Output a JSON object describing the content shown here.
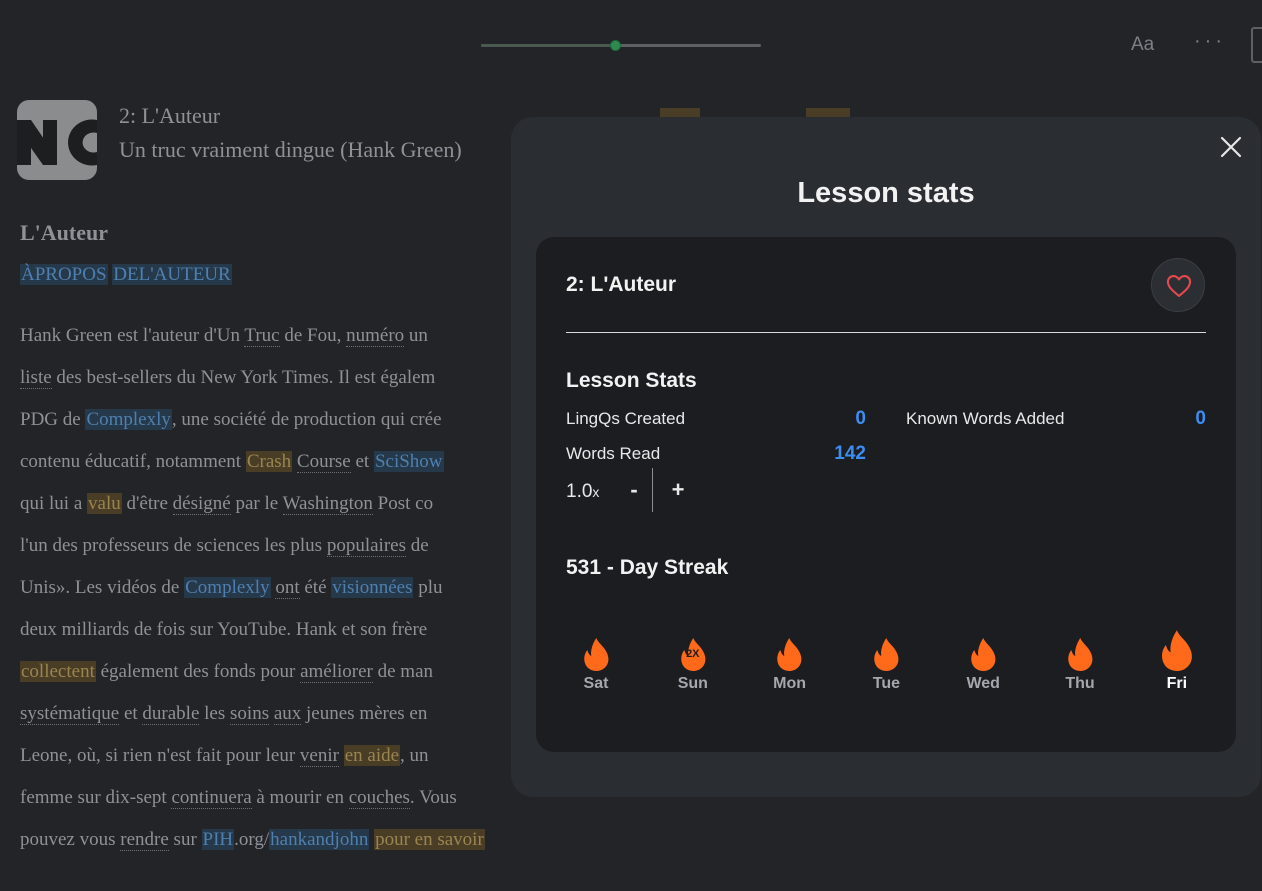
{
  "topbar": {
    "progress": 0.48,
    "font_button": "Aa",
    "more_button": "···"
  },
  "lesson": {
    "title": "2: L'Auteur",
    "course": "Un truc vraiment dingue (Hank Green)"
  },
  "article": {
    "title": "L'Auteur",
    "subtitle_words": [
      "ÀPROPOS",
      "DEL'AUTEUR"
    ],
    "lines": [
      [
        {
          "t": "Hank Green est l'auteur d'Un "
        },
        {
          "t": "Truc",
          "c": "u"
        },
        {
          "t": " de Fou, "
        },
        {
          "t": "numéro",
          "c": "u"
        },
        {
          "t": " un"
        }
      ],
      [
        {
          "t": "liste",
          "c": "u"
        },
        {
          "t": " des best-sellers du New York Times.  Il est égalem"
        }
      ],
      [
        {
          "t": "PDG de "
        },
        {
          "t": "Complexly",
          "c": "link"
        },
        {
          "t": ", une société de production qui crée"
        }
      ],
      [
        {
          "t": "contenu éducatif, notamment "
        },
        {
          "t": "Crash",
          "c": "new"
        },
        {
          "t": " "
        },
        {
          "t": "Course",
          "c": "u"
        },
        {
          "t": " et "
        },
        {
          "t": "SciShow",
          "c": "link"
        }
      ],
      [
        {
          "t": "qui lui a "
        },
        {
          "t": "valu",
          "c": "new"
        },
        {
          "t": " d'être "
        },
        {
          "t": "désigné",
          "c": "u"
        },
        {
          "t": " par le "
        },
        {
          "t": "Washington",
          "c": "u"
        },
        {
          "t": " Post co"
        }
      ],
      [
        {
          "t": "l'un des professeurs de sciences les plus "
        },
        {
          "t": "populaires",
          "c": "u"
        },
        {
          "t": " de"
        }
      ],
      [
        {
          "t": "Unis».  Les vidéos de "
        },
        {
          "t": "Complexly",
          "c": "link"
        },
        {
          "t": " "
        },
        {
          "t": "ont",
          "c": "u"
        },
        {
          "t": " été "
        },
        {
          "t": "visionnées",
          "c": "link"
        },
        {
          "t": " plu"
        }
      ],
      [
        {
          "t": "deux milliards de fois sur YouTube.  Hank et son frère"
        }
      ],
      [
        {
          "t": "collectent",
          "c": "new"
        },
        {
          "t": " également des fonds pour "
        },
        {
          "t": "améliorer",
          "c": "u"
        },
        {
          "t": " de man"
        }
      ],
      [
        {
          "t": "systématique",
          "c": "u"
        },
        {
          "t": " et "
        },
        {
          "t": "durable",
          "c": "u"
        },
        {
          "t": " les "
        },
        {
          "t": "soins",
          "c": "u"
        },
        {
          "t": " "
        },
        {
          "t": "aux",
          "c": "u"
        },
        {
          "t": " jeunes mères en"
        }
      ],
      [
        {
          "t": "Leone, où, si rien n'est fait pour leur "
        },
        {
          "t": "venir",
          "c": "u"
        },
        {
          "t": " "
        },
        {
          "t": "en aide",
          "c": "new"
        },
        {
          "t": ", un"
        }
      ],
      [
        {
          "t": "femme sur dix-sept "
        },
        {
          "t": "continuera",
          "c": "u"
        },
        {
          "t": " à mourir en "
        },
        {
          "t": "couches",
          "c": "u"
        },
        {
          "t": ".  Vous"
        }
      ],
      [
        {
          "t": "pouvez vous "
        },
        {
          "t": "rendre",
          "c": "u"
        },
        {
          "t": " sur "
        },
        {
          "t": "PIH",
          "c": "link"
        },
        {
          "t": ".org/"
        },
        {
          "t": "hankandjohn",
          "c": "link"
        },
        {
          "t": " "
        },
        {
          "t": "pour en savoir",
          "c": "new"
        }
      ]
    ]
  },
  "modal": {
    "title": "Lesson stats",
    "lesson_title": "2: L'Auteur",
    "stats_heading": "Lesson Stats",
    "stats": {
      "lingqs_label": "LingQs Created",
      "lingqs_value": "0",
      "known_label": "Known Words Added",
      "known_value": "0",
      "words_label": "Words Read",
      "words_value": "142"
    },
    "speed": {
      "value": "1.0",
      "unit": "x",
      "minus": "-",
      "plus": "+"
    },
    "streak_heading": "531 - Day Streak",
    "days": [
      {
        "label": "Sat",
        "mult": ""
      },
      {
        "label": "Sun",
        "mult": "2X"
      },
      {
        "label": "Mon",
        "mult": ""
      },
      {
        "label": "Tue",
        "mult": ""
      },
      {
        "label": "Wed",
        "mult": ""
      },
      {
        "label": "Thu",
        "mult": ""
      },
      {
        "label": "Fri",
        "mult": "",
        "today": true
      }
    ]
  },
  "colors": {
    "accent_blue": "#3d8df0",
    "flame": "#ff6a1a",
    "heart": "#e5484d"
  }
}
